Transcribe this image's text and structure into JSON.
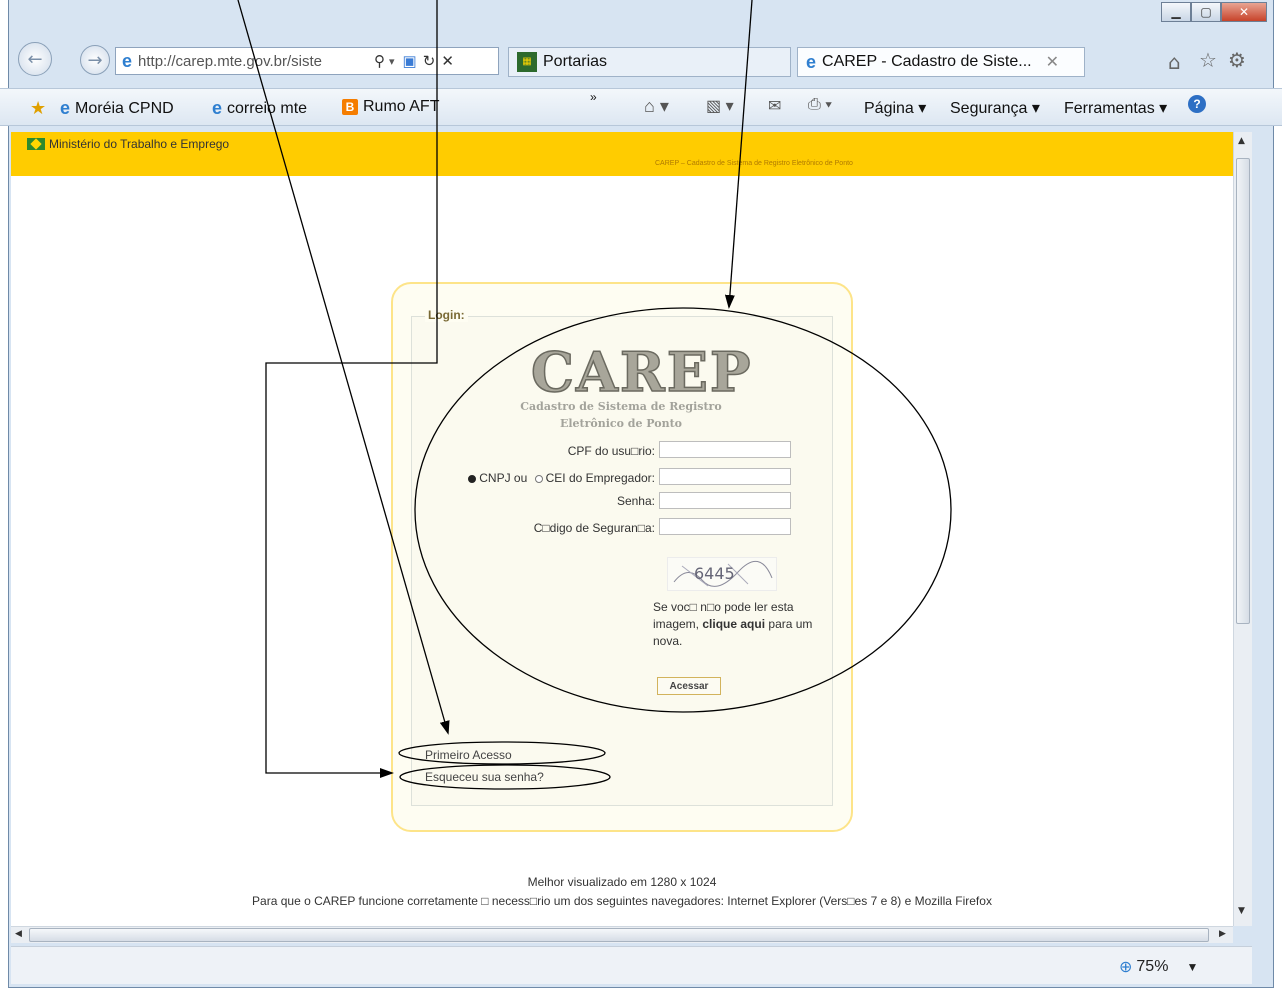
{
  "browser": {
    "address_url": "http://carep.mte.gov.br/siste",
    "tabs": [
      {
        "label": "Portarias"
      },
      {
        "label": "CAREP - Cadastro de Siste..."
      }
    ],
    "favorites": [
      {
        "label": "Moréia CPND"
      },
      {
        "label": "correio mte"
      },
      {
        "label": "Rumo AFT"
      }
    ],
    "command_bar": {
      "page_label": "Página ▾",
      "safety_label": "Segurança ▾",
      "tools_label": "Ferramentas ▾"
    },
    "zoom_label": "75%"
  },
  "page": {
    "banner": {
      "ministry": "Ministério do Trabalho e Emprego",
      "subtitle": "CAREP – Cadastro de Sistema de Registro Eletrônico de Ponto"
    },
    "login": {
      "legend": "Login:",
      "logo_text": "CAREP",
      "logo_subtitle_line1": "Cadastro de Sistema de Registro",
      "logo_subtitle_line2": "Eletrônico de Ponto",
      "cpf_label": "CPF do usu□rio:",
      "cnpj_label": "CNPJ ou",
      "cei_label": "CEI do Empregador:",
      "senha_label": "Senha:",
      "codigo_label": "C□digo de Seguran□a:",
      "captcha_text": "6445",
      "captcha_help_1": "Se voc□ n□o pode ler esta imagem,",
      "captcha_help_link": "clique aqui",
      "captcha_help_2": "para um nova.",
      "submit_label": "Acessar",
      "first_access_link": "Primeiro Acesso",
      "forgot_link": "Esqueceu sua senha?"
    },
    "footer": {
      "line1": "Melhor visualizado em 1280 x 1024",
      "line2": "Para que o CAREP funcione corretamente □ necess□rio um dos seguintes navegadores: Internet Explorer (Vers□es 7 e 8) e Mozilla Firefox"
    }
  },
  "colors": {
    "banner": "#ffcc00",
    "annotation": "#000000"
  }
}
